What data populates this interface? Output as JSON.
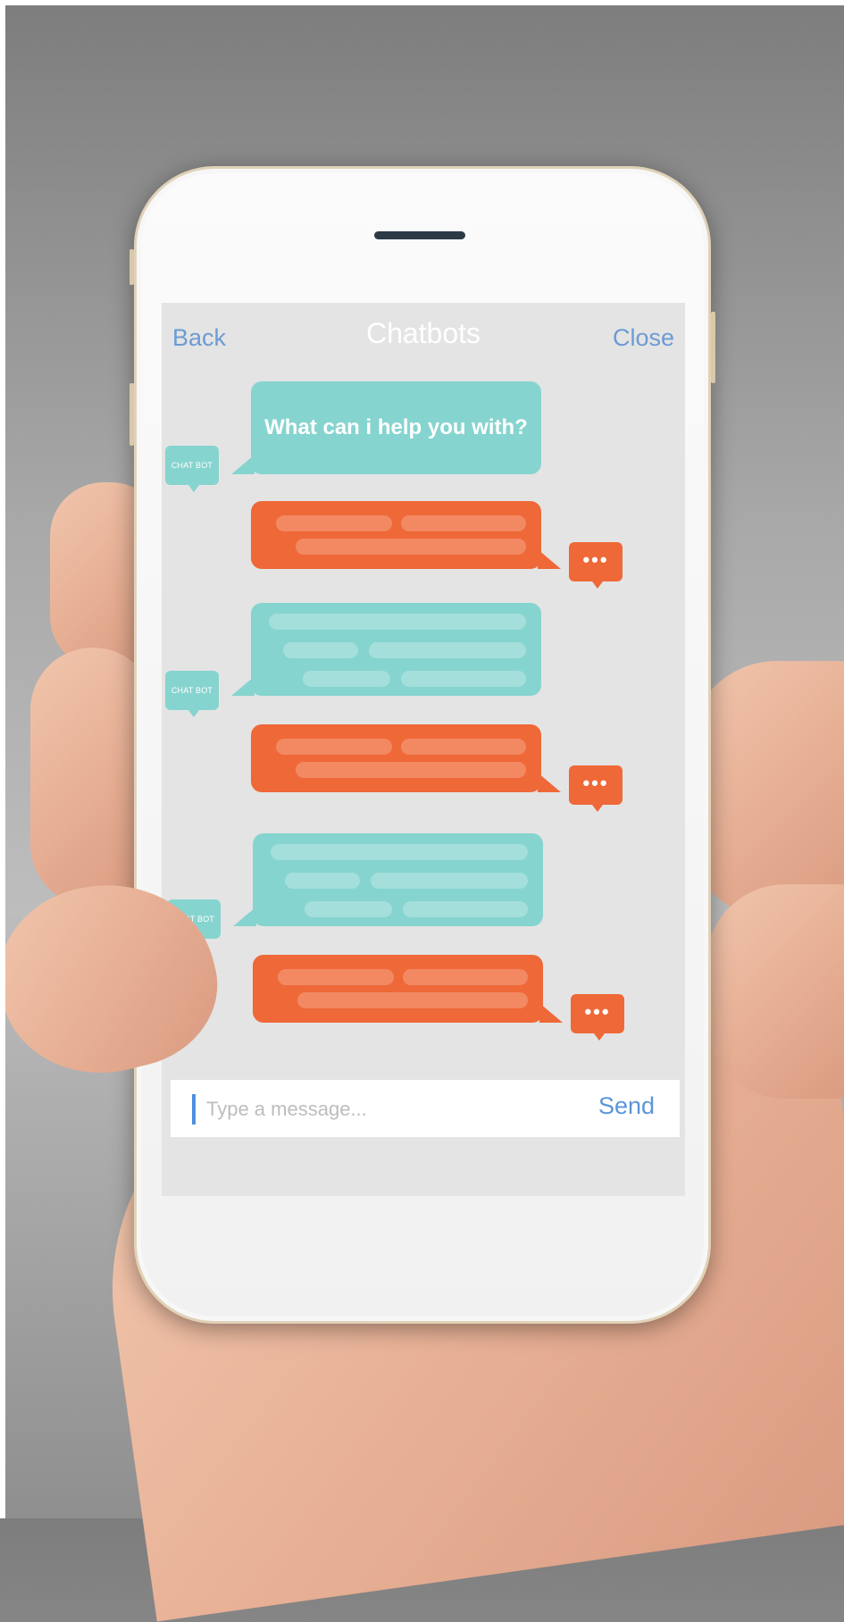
{
  "header": {
    "back_label": "Back",
    "title": "Chatbots",
    "close_label": "Close"
  },
  "conversation": {
    "bot_avatar_label": "CHAT BOT",
    "first_bot_message": "What can i help you with?",
    "typing_indicator": "•••"
  },
  "composer": {
    "placeholder": "Type a message...",
    "send_label": "Send"
  },
  "colors": {
    "bot_bubble": "#86d4cf",
    "user_bubble": "#ef6838",
    "link_blue": "#6c9bd4"
  }
}
